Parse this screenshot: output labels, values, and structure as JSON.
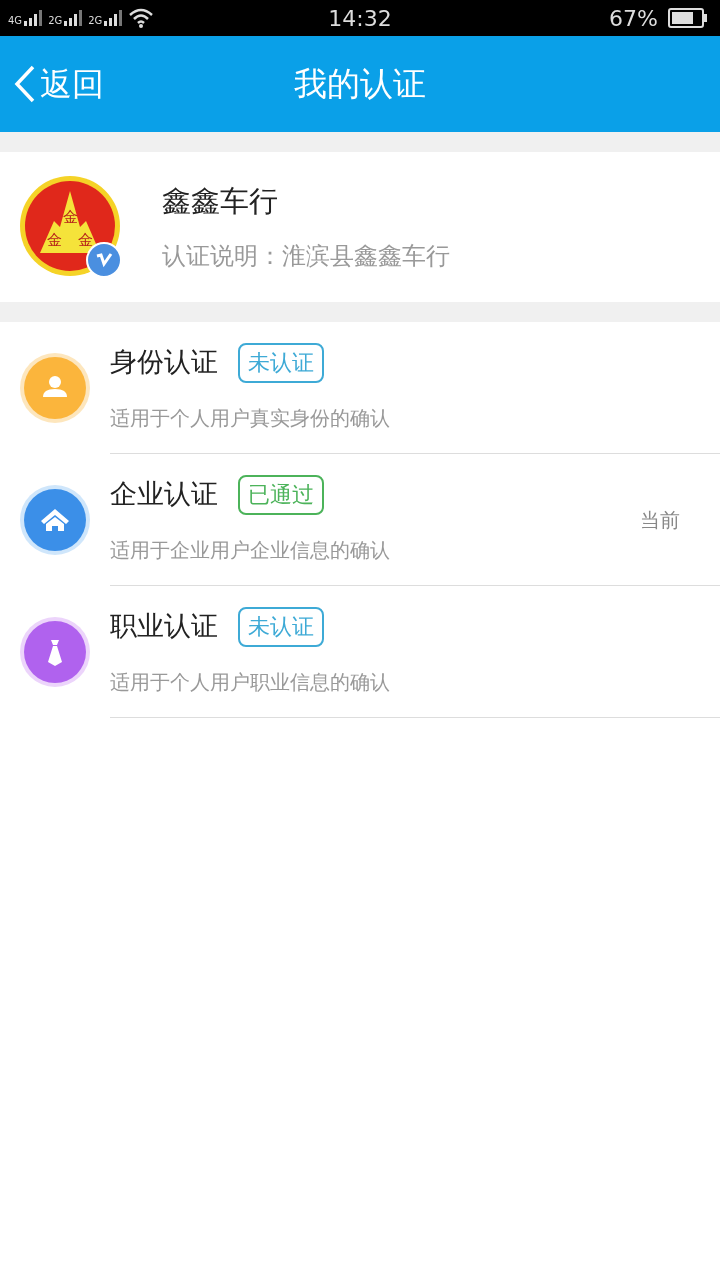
{
  "status_bar": {
    "networks": [
      "4G",
      "2G",
      "2G"
    ],
    "time": "14:32",
    "battery": "67%"
  },
  "header": {
    "back": "返回",
    "title": "我的认证"
  },
  "profile": {
    "logo_marks": [
      "金",
      "金",
      "金"
    ],
    "name": "鑫鑫车行",
    "description": "认证说明：淮滨县鑫鑫车行"
  },
  "items": [
    {
      "kind": "person",
      "title": "身份认证",
      "status": "未认证",
      "passed": false,
      "subtitle": "适用于个人用户真实身份的确认"
    },
    {
      "kind": "house",
      "title": "企业认证",
      "status": "已通过",
      "passed": true,
      "subtitle": "适用于企业用户企业信息的确认",
      "note": "当前"
    },
    {
      "kind": "tie",
      "title": "职业认证",
      "status": "未认证",
      "passed": false,
      "subtitle": "适用于个人用户职业信息的确认"
    }
  ]
}
